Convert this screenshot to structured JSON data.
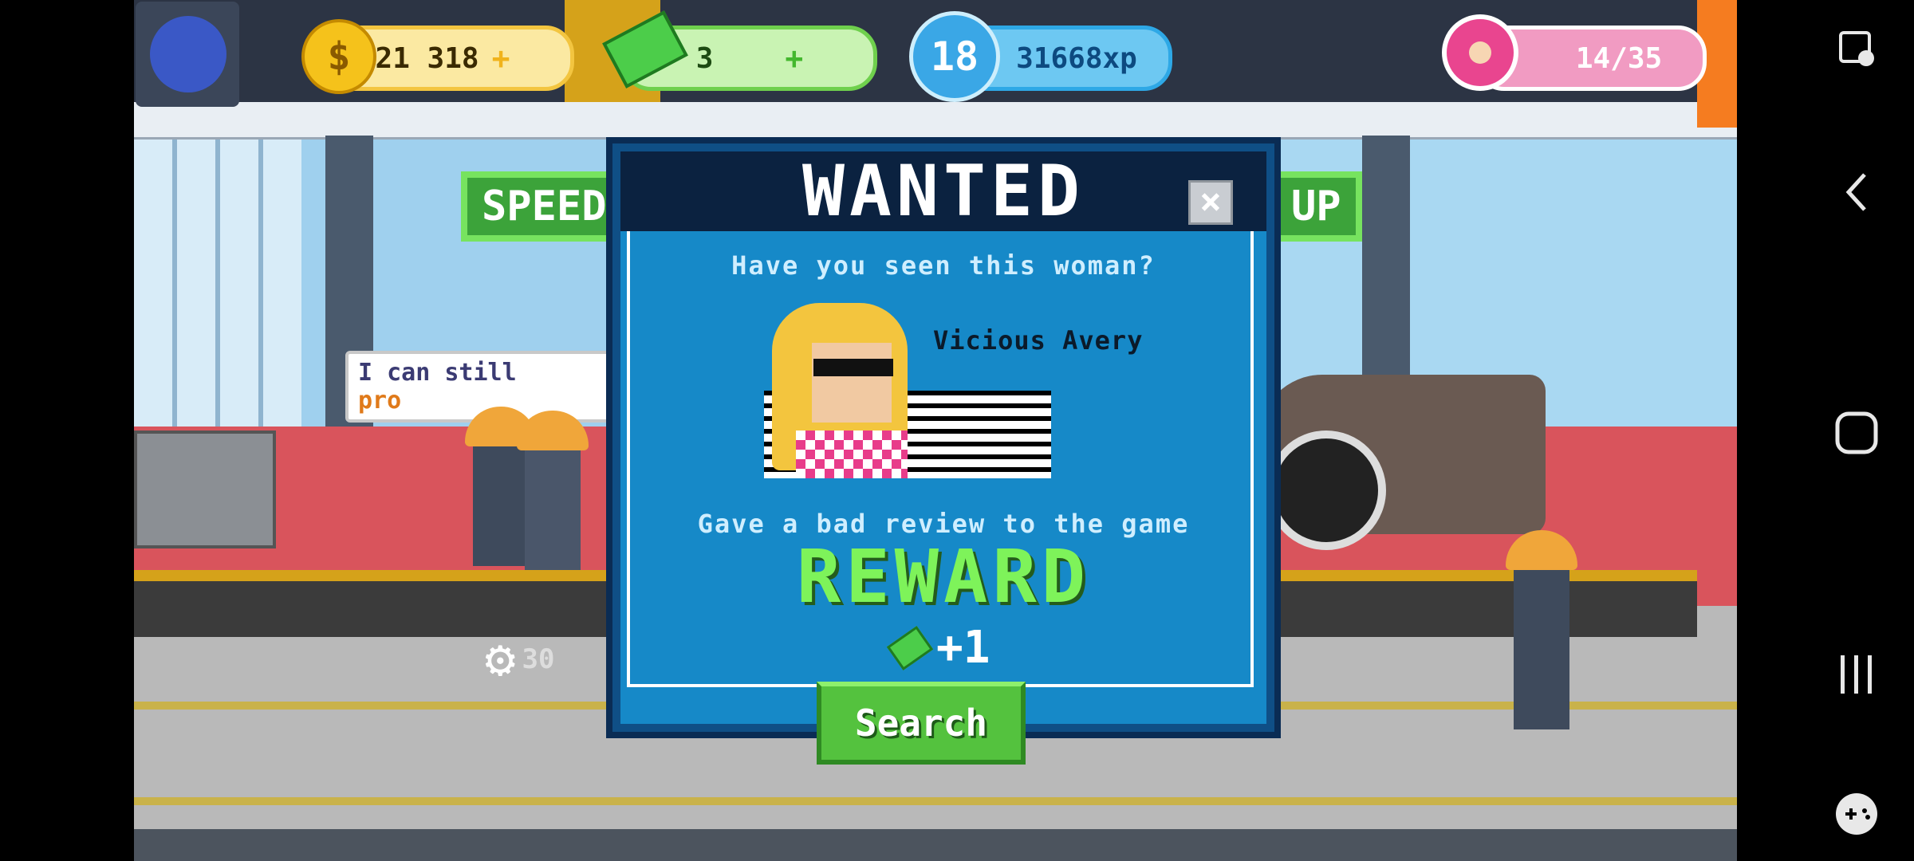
{
  "hud": {
    "coins": "21 318",
    "coins_plus": "+",
    "cash": "3",
    "cash_plus": "+",
    "level": "18",
    "xp": "31668xp",
    "donuts": "14/35"
  },
  "scene": {
    "sign_left": "SPEED",
    "sign_right": "UP",
    "bubble_line1": "I can still",
    "bubble_line2": "pro",
    "gear_counter": "30"
  },
  "modal": {
    "title": "WANTED",
    "subtitle": "Have you seen this woman?",
    "name": "Vicious Avery",
    "crime": "Gave a bad review to the game",
    "reward_label": "REWARD",
    "reward_amount": "+1",
    "search_label": "Search",
    "close_label": "×"
  },
  "colors": {
    "coin": "#f5c21b",
    "cash": "#4ccd4a",
    "xp": "#2ea8e6",
    "donut": "#e9458f",
    "modal_bg": "#1689c8",
    "reward_green": "#7ef35a"
  },
  "nav": {
    "icons": [
      "screenshot-icon",
      "back-icon",
      "home-icon",
      "recents-icon",
      "game-tools-icon"
    ]
  }
}
